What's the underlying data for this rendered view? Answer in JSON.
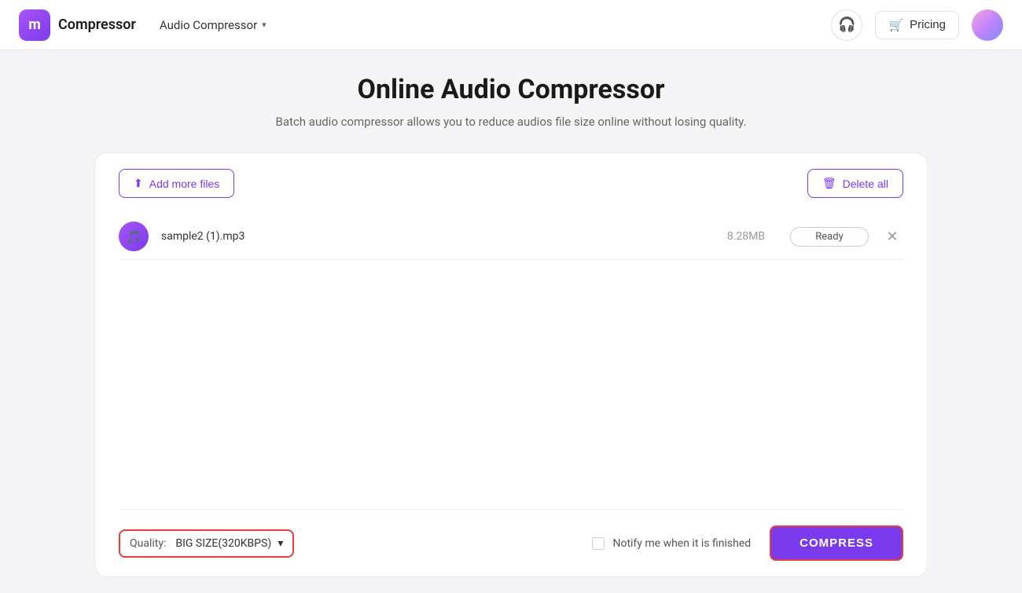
{
  "header": {
    "logo_letter": "m",
    "app_name": "Compressor",
    "nav_label": "Audio Compressor",
    "pricing_label": "Pricing"
  },
  "page": {
    "title": "Online Audio Compressor",
    "subtitle": "Batch audio compressor allows you to reduce audios file size online without losing quality."
  },
  "toolbar": {
    "add_files_label": "Add more files",
    "delete_all_label": "Delete all"
  },
  "files": [
    {
      "name": "sample2 (1).mp3",
      "size": "8.28MB",
      "status": "Ready"
    }
  ],
  "footer": {
    "quality_label": "Quality:",
    "quality_value": "BIG SIZE(320KBPS)",
    "notify_label": "Notify me when it is finished",
    "compress_label": "COMPRESS"
  }
}
